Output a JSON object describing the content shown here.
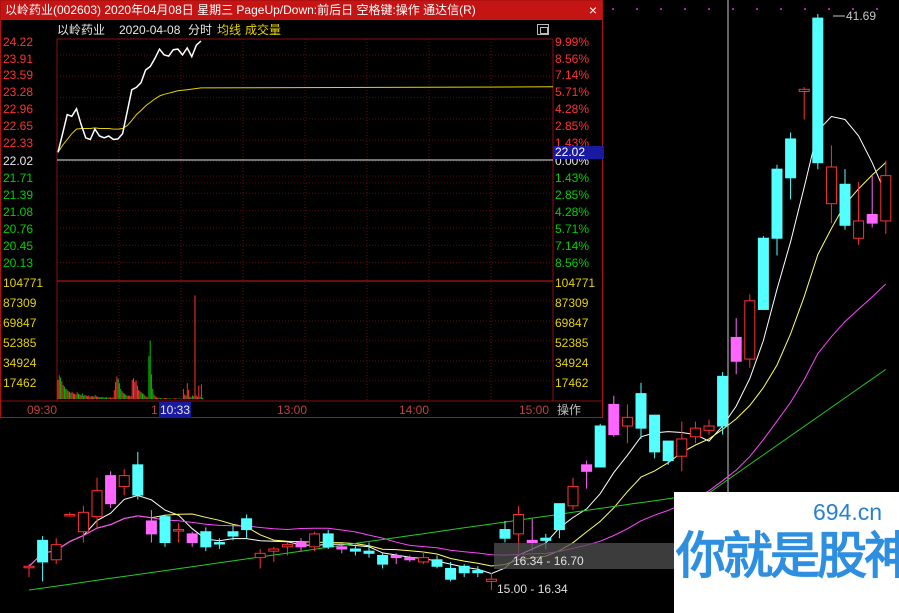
{
  "window": {
    "title": "以岭药业(002603)  2020年04月08日  星期三  PageUp/Down:前后日  空格键:操作  通达信(R)",
    "close_glyph": "×"
  },
  "infobar": {
    "stock_name": "以岭药业",
    "date": "2020-04-08",
    "chart_kind": "分时",
    "avg_line": "均线",
    "volume": "成交量"
  },
  "price_axis_left": [
    "24.22",
    "23.91",
    "23.59",
    "23.28",
    "22.96",
    "22.65",
    "22.33",
    "22.02",
    "21.71",
    "21.39",
    "21.08",
    "20.76",
    "20.45",
    "20.13"
  ],
  "pct_axis_right": [
    "9.99%",
    "8.56%",
    "7.14%",
    "5.71%",
    "4.28%",
    "2.85%",
    "1.43%",
    "0.00%",
    "1.43%",
    "2.85%",
    "4.28%",
    "5.71%",
    "7.14%",
    "8.56%"
  ],
  "volume_axis_left": [
    "104771",
    "87309",
    "69847",
    "52385",
    "34924",
    "17462"
  ],
  "volume_axis_right": [
    "104771",
    "87309",
    "69847",
    "52385",
    "34924",
    "17462"
  ],
  "time_axis": {
    "t0930": "09:30",
    "t1130": "1",
    "t1300": "13:00",
    "t1400": "14:00",
    "t1500": "15:00"
  },
  "cursor": {
    "time": "10:33",
    "price": "22.02"
  },
  "operate_label": "操作",
  "kline": {
    "peak_label": "41.69",
    "range_upper": "16.34 - 16.70",
    "range_lower": "15.00 - 16.34"
  },
  "watermark": {
    "url": "694.cn",
    "text": "你就是股神"
  },
  "colors": {
    "up": "#ff3232",
    "down": "#00d000",
    "bull_candle": "#ff66ff",
    "bear_candle": "#54ffff",
    "title_bar": "#c41414"
  },
  "chart_data": [
    {
      "type": "line",
      "title": "分时",
      "x": [
        "09:30",
        "09:32",
        "09:34",
        "09:36",
        "09:38",
        "09:40",
        "09:42",
        "09:44",
        "09:46",
        "09:48",
        "09:50",
        "09:52",
        "09:54",
        "09:56",
        "09:58",
        "10:00",
        "10:02",
        "10:04",
        "10:06",
        "10:08",
        "10:10",
        "10:12",
        "10:14",
        "10:16",
        "10:18",
        "10:20",
        "10:22",
        "10:24",
        "10:26",
        "10:28",
        "10:30",
        "10:33"
      ],
      "series": [
        {
          "name": "价格",
          "values": [
            22.3,
            22.62,
            22.95,
            22.92,
            23.05,
            22.78,
            22.55,
            22.52,
            22.7,
            22.58,
            22.55,
            22.58,
            22.52,
            22.53,
            22.62,
            23.0,
            23.38,
            23.42,
            23.5,
            23.72,
            23.78,
            23.92,
            24.08,
            23.98,
            23.96,
            24.07,
            24.08,
            23.98,
            24.1,
            23.95,
            24.15,
            24.22
          ]
        },
        {
          "name": "均线",
          "values": [
            22.3,
            22.42,
            22.52,
            22.62,
            22.7,
            22.71,
            22.71,
            22.71,
            22.72,
            22.71,
            22.71,
            22.71,
            22.7,
            22.7,
            22.71,
            22.76,
            22.85,
            22.95,
            23.02,
            23.1,
            23.16,
            23.22,
            23.27,
            23.3,
            23.32,
            23.34,
            23.36,
            23.37,
            23.38,
            23.39,
            23.4,
            23.41
          ]
        }
      ],
      "ylim": [
        20.13,
        24.22
      ],
      "prev_close": 22.02
    },
    {
      "type": "bar",
      "title": "成交量",
      "ylim": [
        0,
        104771
      ],
      "values": [
        17000,
        21000,
        19000,
        15500,
        12500,
        11000,
        9000,
        8500,
        7000,
        6500,
        5500,
        6500,
        5000,
        4500,
        4000,
        6000,
        4500,
        4000,
        3500,
        5000,
        3000,
        3500,
        3000,
        2500,
        3000,
        2000,
        2500,
        2500,
        2000,
        3500,
        2500,
        2000,
        1800,
        1600,
        1500,
        1800,
        1500,
        1400,
        1500,
        1300,
        1200,
        1400,
        1100,
        1300,
        8000,
        15000,
        20000,
        18000,
        14000,
        9000,
        7000,
        5500,
        4500,
        3500,
        3000,
        2800,
        3000,
        2500,
        17000,
        18500,
        15000,
        16500,
        12000,
        8000,
        7000,
        6000,
        5000,
        4500,
        3000,
        2000,
        1500,
        38000,
        52000,
        22000,
        9000,
        4000,
        2500,
        1500,
        1200,
        1000,
        800,
        600,
        500,
        900,
        800,
        700,
        600,
        500,
        400,
        300,
        500,
        600,
        500,
        400,
        300,
        500,
        400,
        300,
        9000,
        4000,
        3000,
        14000,
        8000,
        2000,
        1500,
        3000,
        2500,
        92000,
        3000,
        2000,
        12000,
        2000,
        13000,
        1000
      ],
      "up_flags": [
        1,
        1,
        0,
        1,
        1,
        0,
        1,
        0,
        1,
        1,
        0,
        1,
        0,
        1,
        0,
        1,
        0,
        1,
        1,
        0,
        1,
        0,
        1,
        0,
        1,
        1,
        0,
        1,
        0,
        0,
        1,
        0,
        1,
        0,
        1,
        0,
        0,
        1,
        0,
        1,
        0,
        1,
        0,
        1,
        1,
        1,
        1,
        0,
        1,
        0,
        1,
        1,
        0,
        1,
        0,
        1,
        0,
        1,
        1,
        0,
        1,
        1,
        0,
        1,
        0,
        1,
        0,
        1,
        0,
        1,
        1,
        0,
        0,
        1,
        0,
        1,
        0,
        1,
        0,
        1,
        0,
        1,
        0,
        1,
        0,
        1,
        0,
        1,
        0,
        1,
        0,
        1,
        0,
        1,
        0,
        1,
        0,
        1,
        1,
        1,
        0,
        1,
        1,
        0,
        1,
        0,
        1,
        1,
        1,
        0,
        1,
        0,
        1,
        0
      ]
    },
    {
      "type": "candlestick",
      "title": "日K",
      "ylim": [
        15.0,
        41.69
      ],
      "candles": [
        {
          "o": 16.1,
          "h": 16.2,
          "l": 15.6,
          "c": 16.1,
          "up": 1
        },
        {
          "o": 16.3,
          "h": 17.5,
          "l": 15.4,
          "c": 17.3,
          "up": 0
        },
        {
          "o": 16.4,
          "h": 17.4,
          "l": 16.2,
          "c": 17.1,
          "up": 1
        },
        {
          "o": 18.5,
          "h": 18.6,
          "l": 18.4,
          "c": 18.5,
          "up": 1
        },
        {
          "o": 17.7,
          "h": 18.9,
          "l": 17.2,
          "c": 18.6,
          "up": 1
        },
        {
          "o": 18.4,
          "h": 20.2,
          "l": 17.9,
          "c": 19.6,
          "up": 1
        },
        {
          "o": 20.3,
          "h": 20.5,
          "l": 18.8,
          "c": 19.0,
          "up": 1
        },
        {
          "o": 19.8,
          "h": 20.6,
          "l": 19.4,
          "c": 20.3,
          "up": 1
        },
        {
          "o": 20.8,
          "h": 21.4,
          "l": 19.2,
          "c": 19.4,
          "up": 0
        },
        {
          "o": 18.2,
          "h": 18.7,
          "l": 17.2,
          "c": 17.6,
          "up": 1
        },
        {
          "o": 18.4,
          "h": 18.5,
          "l": 17.0,
          "c": 17.2,
          "up": 0
        },
        {
          "o": 17.8,
          "h": 18.1,
          "l": 17.2,
          "c": 17.8,
          "up": 1
        },
        {
          "o": 17.6,
          "h": 17.7,
          "l": 17.0,
          "c": 17.2,
          "up": 1
        },
        {
          "o": 17.7,
          "h": 17.9,
          "l": 16.8,
          "c": 17.0,
          "up": 0
        },
        {
          "o": 17.2,
          "h": 17.4,
          "l": 16.9,
          "c": 17.2,
          "up": 0
        },
        {
          "o": 17.5,
          "h": 18.0,
          "l": 17.3,
          "c": 17.7,
          "up": 0
        },
        {
          "o": 18.3,
          "h": 18.5,
          "l": 17.4,
          "c": 17.8,
          "up": 0
        },
        {
          "o": 16.5,
          "h": 16.9,
          "l": 16.0,
          "c": 16.7,
          "up": 1
        },
        {
          "o": 16.8,
          "h": 17.0,
          "l": 16.3,
          "c": 16.9,
          "up": 1
        },
        {
          "o": 17.0,
          "h": 17.2,
          "l": 16.6,
          "c": 17.1,
          "up": 1
        },
        {
          "o": 17.2,
          "h": 17.4,
          "l": 16.8,
          "c": 17.0,
          "up": 1
        },
        {
          "o": 17.0,
          "h": 17.7,
          "l": 16.8,
          "c": 17.6,
          "up": 1
        },
        {
          "o": 17.6,
          "h": 17.8,
          "l": 16.9,
          "c": 17.0,
          "up": 0
        },
        {
          "o": 17.0,
          "h": 17.2,
          "l": 16.7,
          "c": 16.9,
          "up": 1
        },
        {
          "o": 16.9,
          "h": 17.1,
          "l": 16.6,
          "c": 16.8,
          "up": 0
        },
        {
          "o": 16.8,
          "h": 17.2,
          "l": 16.5,
          "c": 16.7,
          "up": 0
        },
        {
          "o": 16.6,
          "h": 16.7,
          "l": 16.0,
          "c": 16.2,
          "up": 0
        },
        {
          "o": 16.6,
          "h": 16.7,
          "l": 16.2,
          "c": 16.5,
          "up": 1
        },
        {
          "o": 16.5,
          "h": 16.6,
          "l": 16.3,
          "c": 16.4,
          "up": 1
        },
        {
          "o": 16.3,
          "h": 16.8,
          "l": 16.2,
          "c": 16.5,
          "up": 1
        },
        {
          "o": 16.4,
          "h": 16.6,
          "l": 16.0,
          "c": 16.1,
          "up": 0
        },
        {
          "o": 16.0,
          "h": 16.3,
          "l": 15.4,
          "c": 15.5,
          "up": 0
        },
        {
          "o": 16.1,
          "h": 16.2,
          "l": 15.6,
          "c": 15.8,
          "up": 0
        },
        {
          "o": 15.8,
          "h": 16.1,
          "l": 15.6,
          "c": 15.9,
          "up": 0
        },
        {
          "o": 15.4,
          "h": 15.8,
          "l": 15.0,
          "c": 15.5,
          "up": 1
        },
        {
          "o": 17.8,
          "h": 18.2,
          "l": 17.2,
          "c": 17.4,
          "up": 0
        },
        {
          "o": 17.6,
          "h": 18.9,
          "l": 16.7,
          "c": 18.5,
          "up": 1
        },
        {
          "o": 17.3,
          "h": 18.3,
          "l": 16.8,
          "c": 17.2,
          "up": 1
        },
        {
          "o": 17.4,
          "h": 17.6,
          "l": 16.9,
          "c": 17.3,
          "up": 0
        },
        {
          "o": 17.8,
          "h": 19.0,
          "l": 17.4,
          "c": 19.0,
          "up": 0
        },
        {
          "o": 18.9,
          "h": 20.2,
          "l": 18.7,
          "c": 19.8,
          "up": 1
        },
        {
          "o": 20.8,
          "h": 21.0,
          "l": 19.7,
          "c": 20.5,
          "up": 1
        },
        {
          "o": 22.6,
          "h": 22.7,
          "l": 20.7,
          "c": 20.7,
          "up": 0
        },
        {
          "o": 23.6,
          "h": 24.0,
          "l": 22.1,
          "c": 22.2,
          "up": 1
        },
        {
          "o": 22.6,
          "h": 23.6,
          "l": 21.8,
          "c": 23.0,
          "up": 1
        },
        {
          "o": 22.5,
          "h": 24.6,
          "l": 22.0,
          "c": 24.1,
          "up": 0
        },
        {
          "o": 23.1,
          "h": 23.1,
          "l": 21.1,
          "c": 21.4,
          "up": 0
        },
        {
          "o": 21.9,
          "h": 21.9,
          "l": 20.8,
          "c": 21.0,
          "up": 0
        },
        {
          "o": 21.2,
          "h": 22.8,
          "l": 20.5,
          "c": 22.0,
          "up": 1
        },
        {
          "o": 22.1,
          "h": 22.8,
          "l": 21.8,
          "c": 22.5,
          "up": 1
        },
        {
          "o": 22.4,
          "h": 22.9,
          "l": 22.2,
          "c": 22.6,
          "up": 1
        },
        {
          "o": 22.6,
          "h": 25.1,
          "l": 22.2,
          "c": 24.9,
          "up": 0
        },
        {
          "o": 26.7,
          "h": 27.6,
          "l": 25.0,
          "c": 25.6,
          "up": 1
        },
        {
          "o": 25.7,
          "h": 28.7,
          "l": 25.3,
          "c": 28.4,
          "up": 1
        },
        {
          "o": 28.0,
          "h": 31.4,
          "l": 28.0,
          "c": 31.3,
          "up": 0
        },
        {
          "o": 31.3,
          "h": 34.7,
          "l": 30.5,
          "c": 34.5,
          "up": 0
        },
        {
          "o": 34.1,
          "h": 36.2,
          "l": 33.1,
          "c": 35.9,
          "up": 0
        },
        {
          "o": 38.1,
          "h": 38.3,
          "l": 36.8,
          "c": 38.2,
          "up": 1
        },
        {
          "o": 34.8,
          "h": 41.69,
          "l": 34.5,
          "c": 41.5,
          "up": 0
        },
        {
          "o": 32.9,
          "h": 35.6,
          "l": 32.0,
          "c": 34.6,
          "up": 1
        },
        {
          "o": 31.9,
          "h": 34.5,
          "l": 31.7,
          "c": 33.8,
          "up": 0
        },
        {
          "o": 31.3,
          "h": 33.9,
          "l": 31.0,
          "c": 32.1,
          "up": 1
        },
        {
          "o": 32.4,
          "h": 34.2,
          "l": 31.8,
          "c": 32.0,
          "up": 1
        },
        {
          "o": 32.1,
          "h": 34.9,
          "l": 31.5,
          "c": 34.2,
          "up": 1
        }
      ]
    }
  ]
}
